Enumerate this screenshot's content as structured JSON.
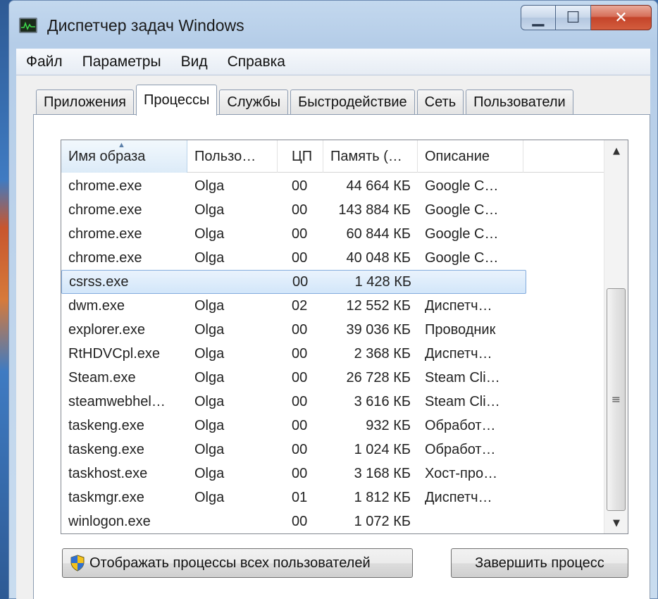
{
  "window": {
    "title": "Диспетчер задач Windows",
    "controls": {
      "minimize": "▁",
      "maximize": "☐",
      "close": "✕"
    }
  },
  "menu": [
    "Файл",
    "Параметры",
    "Вид",
    "Справка"
  ],
  "tabs": [
    {
      "label": "Приложения",
      "active": false
    },
    {
      "label": "Процессы",
      "active": true
    },
    {
      "label": "Службы",
      "active": false
    },
    {
      "label": "Быстродействие",
      "active": false
    },
    {
      "label": "Сеть",
      "active": false
    },
    {
      "label": "Пользователи",
      "active": false
    }
  ],
  "columns": {
    "name": "Имя образа",
    "user": "Пользо…",
    "cpu": "ЦП",
    "memory": "Память (…",
    "description": "Описание"
  },
  "processes": [
    {
      "name": "chrome.exe",
      "user": "Olga",
      "cpu": "00",
      "memory": "44 664 КБ",
      "description": "Google C…"
    },
    {
      "name": "chrome.exe",
      "user": "Olga",
      "cpu": "00",
      "memory": "143 884 КБ",
      "description": "Google C…"
    },
    {
      "name": "chrome.exe",
      "user": "Olga",
      "cpu": "00",
      "memory": "60 844 КБ",
      "description": "Google C…"
    },
    {
      "name": "chrome.exe",
      "user": "Olga",
      "cpu": "00",
      "memory": "40 048 КБ",
      "description": "Google C…"
    },
    {
      "name": "csrss.exe",
      "user": "",
      "cpu": "00",
      "memory": "1 428 КБ",
      "description": ""
    },
    {
      "name": "dwm.exe",
      "user": "Olga",
      "cpu": "02",
      "memory": "12 552 КБ",
      "description": "Диспетч…"
    },
    {
      "name": "explorer.exe",
      "user": "Olga",
      "cpu": "00",
      "memory": "39 036 КБ",
      "description": "Проводник"
    },
    {
      "name": "RtHDVCpl.exe",
      "user": "Olga",
      "cpu": "00",
      "memory": "2 368 КБ",
      "description": "Диспетч…"
    },
    {
      "name": "Steam.exe",
      "user": "Olga",
      "cpu": "00",
      "memory": "26 728 КБ",
      "description": "Steam Cli…"
    },
    {
      "name": "steamwebhel…",
      "user": "Olga",
      "cpu": "00",
      "memory": "3 616 КБ",
      "description": "Steam Cli…"
    },
    {
      "name": "taskeng.exe",
      "user": "Olga",
      "cpu": "00",
      "memory": "932 КБ",
      "description": "Обработ…"
    },
    {
      "name": "taskeng.exe",
      "user": "Olga",
      "cpu": "00",
      "memory": "1 024 КБ",
      "description": "Обработ…"
    },
    {
      "name": "taskhost.exe",
      "user": "Olga",
      "cpu": "00",
      "memory": "3 168 КБ",
      "description": "Хост-про…"
    },
    {
      "name": "taskmgr.exe",
      "user": "Olga",
      "cpu": "01",
      "memory": "1 812 КБ",
      "description": "Диспетч…"
    },
    {
      "name": "winlogon.exe",
      "user": "",
      "cpu": "00",
      "memory": "1 072 КБ",
      "description": ""
    }
  ],
  "selected_index": 4,
  "buttons": {
    "show_all": "Отображать процессы всех пользователей",
    "end_process": "Завершить процесс"
  },
  "icons": {
    "app": "task-manager-icon",
    "shield": "uac-shield-icon",
    "sort": "sort-ascending-icon"
  }
}
